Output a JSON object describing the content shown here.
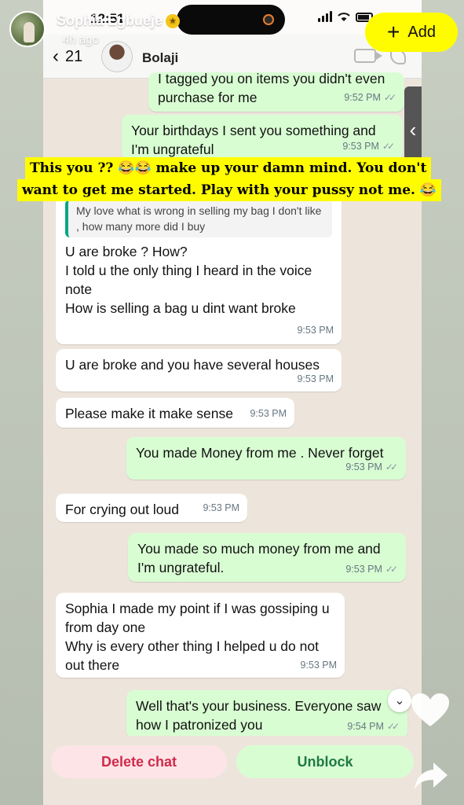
{
  "story": {
    "username": "Sophia Egbueje",
    "posted_ago": "4h ago",
    "add_label": "Add"
  },
  "status_bar": {
    "time": "12:51"
  },
  "chat": {
    "back_count": "21",
    "contact_name": "Bolaji"
  },
  "caption": {
    "line1": "This you ?? 😂😂 make up your damn mind. You don't",
    "line2": "want to get me started. Play with your pussy not me. 😂"
  },
  "messages": [
    {
      "dir": "out",
      "text": "I tagged you on items you didn't even purchase for me",
      "time": "9:52 PM"
    },
    {
      "dir": "out",
      "text": "Your birthdays I sent  you something and I'm ungrateful",
      "time": "9:53 PM"
    },
    {
      "dir": "in",
      "quote": "My love what is wrong in selling my bag I don't like , how many more did I buy",
      "text": "U are broke ? How?\nI told u the only thing I heard in the voice note\nHow is selling a bag u dint want broke",
      "time": "9:53 PM"
    },
    {
      "dir": "in",
      "text": "U are broke and you have several houses",
      "time": "9:53 PM"
    },
    {
      "dir": "in",
      "text": "Please make it make sense",
      "time": "9:53 PM"
    },
    {
      "dir": "out",
      "text": "You made Money from me . Never forget",
      "time": "9:53 PM"
    },
    {
      "dir": "in",
      "text": "For crying out loud",
      "time": "9:53 PM"
    },
    {
      "dir": "out",
      "text": "You made so much money from me and I'm ungrateful.",
      "time": "9:53 PM"
    },
    {
      "dir": "in",
      "text": "Sophia I made my point if I was gossiping u from day one\nWhy is every other thing I helped u do not out there",
      "time": "9:53 PM"
    },
    {
      "dir": "out",
      "text": "Well that's your business. Everyone saw how I patronized you",
      "time": "9:54 PM"
    }
  ],
  "actions": {
    "delete_label": "Delete chat",
    "unblock_label": "Unblock"
  },
  "colors": {
    "outgoing_bubble": "#d9fdd3",
    "incoming_bubble": "#ffffff",
    "caption_highlight": "#fffc00",
    "delete_text": "#d02a4a",
    "unblock_text": "#1f7a44"
  }
}
